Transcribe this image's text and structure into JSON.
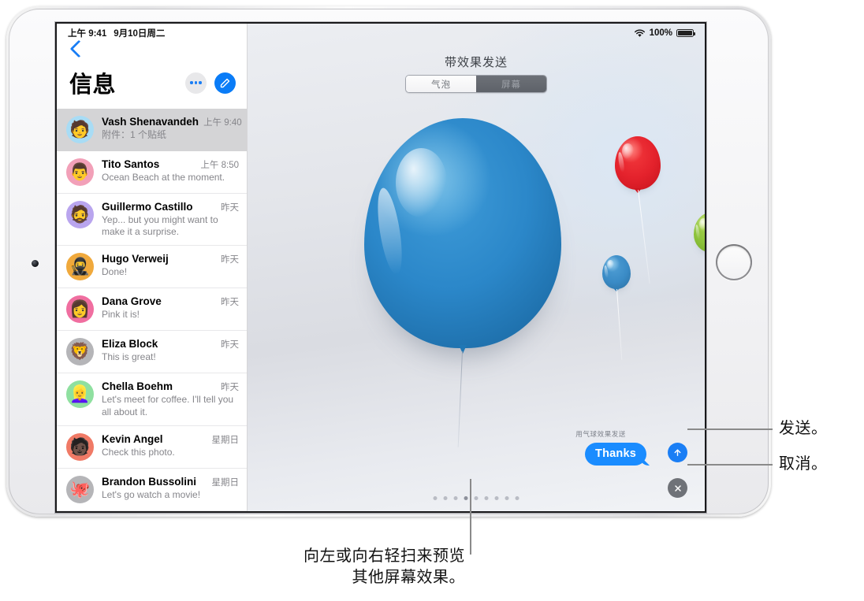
{
  "status_bar": {
    "time": "上午 9:41",
    "date": "9月10日周二",
    "wifi_icon": "wifi-icon",
    "battery_percent": "100%",
    "battery_icon": "battery-full-icon"
  },
  "sidebar": {
    "back_icon": "chevron-left-icon",
    "title": "信息",
    "more_button": "more-dots-icon",
    "compose_button": "compose-icon",
    "conversations": [
      {
        "name": "Vash Shenavandeh",
        "time": "上午 9:40",
        "preview": "附件：1 个贴纸",
        "avatar": "🧑",
        "avatar_bg": "#a8dcf5",
        "selected": true
      },
      {
        "name": "Tito Santos",
        "time": "上午 8:50",
        "preview": "Ocean Beach at the moment.",
        "avatar": "👨",
        "avatar_bg": "#f2a0b8",
        "selected": false
      },
      {
        "name": "Guillermo Castillo",
        "time": "昨天",
        "preview": "Yep... but you might want to make it a surprise.",
        "avatar": "🧔",
        "avatar_bg": "#b9a5ee",
        "selected": false
      },
      {
        "name": "Hugo Verweij",
        "time": "昨天",
        "preview": "Done!",
        "avatar": "🥷",
        "avatar_bg": "#f0a93c",
        "selected": false
      },
      {
        "name": "Dana Grove",
        "time": "昨天",
        "preview": "Pink it is!",
        "avatar": "👩",
        "avatar_bg": "#f06ea0",
        "selected": false
      },
      {
        "name": "Eliza Block",
        "time": "昨天",
        "preview": "This is great!",
        "avatar": "🦁",
        "avatar_bg": "#b5b5b8",
        "selected": false
      },
      {
        "name": "Chella Boehm",
        "time": "昨天",
        "preview": "Let's meet for coffee. I'll tell you all about it.",
        "avatar": "👱‍♀️",
        "avatar_bg": "#8fe0a0",
        "selected": false
      },
      {
        "name": "Kevin Angel",
        "time": "星期日",
        "preview": "Check this photo.",
        "avatar": "🧑🏿",
        "avatar_bg": "#f07a66",
        "selected": false
      },
      {
        "name": "Brandon Bussolini",
        "time": "星期日",
        "preview": "Let's go watch a movie!",
        "avatar": "🐙",
        "avatar_bg": "#b5b5b8",
        "selected": false
      }
    ]
  },
  "effects_panel": {
    "title": "带效果发送",
    "segments": [
      {
        "label": "气泡",
        "selected": true
      },
      {
        "label": "屏幕",
        "selected": false
      }
    ],
    "send_hint": "用气球效果发送",
    "bubble_text": "Thanks",
    "send_button": "send-arrow-up-icon",
    "cancel_button": "cancel-x-icon",
    "page_dots": {
      "count": 9,
      "active_index": 3
    },
    "balloons": [
      {
        "name": "large-blue-balloon",
        "color": "#2b87c9"
      },
      {
        "name": "red-balloon",
        "color": "#ee2b34"
      },
      {
        "name": "green-balloon",
        "color": "#8cc63e"
      },
      {
        "name": "small-blue-balloon",
        "color": "#3f8fc9"
      }
    ]
  },
  "callouts": {
    "send": "发送。",
    "cancel": "取消。",
    "swipe": "向左或向右轻扫来预览\n其他屏幕效果。"
  }
}
